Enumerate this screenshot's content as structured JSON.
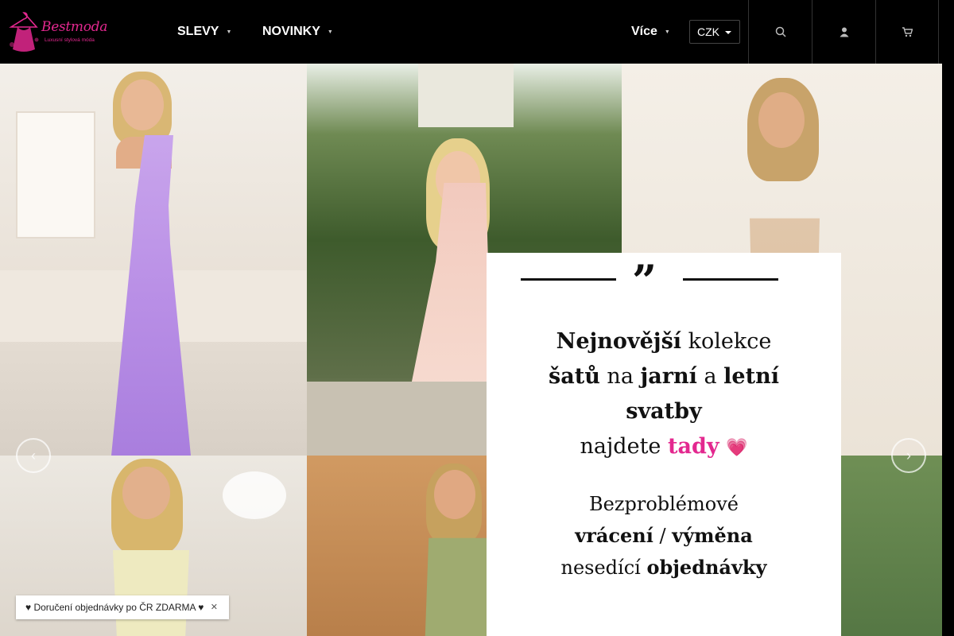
{
  "header": {
    "logo": {
      "name": "Bestmoda",
      "tagline": "Luxusní stylová móda",
      "icon": "hanger-dress-icon"
    },
    "nav": {
      "slevy": "SLEVY",
      "novinky": "NOVINKY",
      "vice": "Více",
      "caret_icon": "chevron-down-icon"
    },
    "currency": {
      "selected": "CZK"
    },
    "buttons": [
      {
        "icon": "search-icon"
      },
      {
        "icon": "user-icon"
      },
      {
        "icon": "cart-icon"
      }
    ]
  },
  "banner": {
    "quote": {
      "line1_bold": "Nejnovější",
      "line1_rest": " kolekce",
      "line2_bold_a": "šatů",
      "line2_mid": " na ",
      "line2_bold_b": "jarní",
      "line2_and": " a ",
      "line2_bold_c": "letní",
      "line3_bold": "svatby",
      "line4_pre": "najdete ",
      "line4_link": "tady",
      "line4_emoji": "💗",
      "line5": "Bezproblémové",
      "line6_a": "vrácení",
      "line6_sep": " / ",
      "line6_b": "výměna",
      "line7_pre": "nesedící ",
      "line7_bold": "objednávky"
    },
    "arrows": {
      "left_icon": "arrow-left-icon",
      "right_icon": "arrow-right-icon"
    }
  },
  "promo": {
    "text": "♥ Doručení objednávky po ČR ZDARMA ♥",
    "close_icon": "close-icon"
  },
  "colors": {
    "brand": "#e3288f",
    "header_bg": "#000000"
  }
}
